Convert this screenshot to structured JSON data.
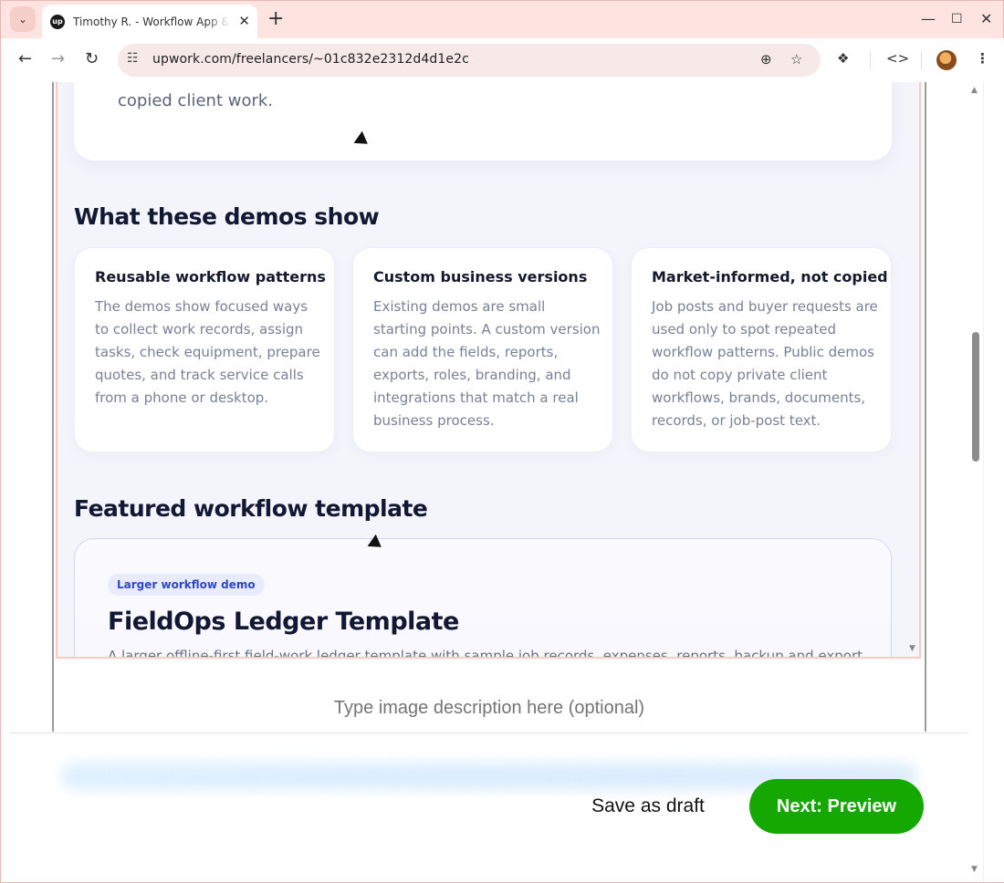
{
  "browser": {
    "tab_title": "Timothy R. - Workflow App &",
    "favicon_text": "up",
    "url": "upwork.com/freelancers/~01c832e2312d4d1e2c"
  },
  "preview": {
    "top_card_text": "copied client work.",
    "section_demos_title": "What these demos show",
    "features": [
      {
        "title": "Reusable workflow patterns",
        "body": "The demos show focused ways to collect work records, assign tasks, check equipment, prepare quotes, and track service calls from a phone or desktop."
      },
      {
        "title": "Custom business versions",
        "body": "Existing demos are small starting points. A custom version can add the fields, reports, exports, roles, branding, and integrations that match a real business process."
      },
      {
        "title": "Market-informed, not copied",
        "body": "Job posts and buyer requests are used only to spot repeated workflow patterns. Public demos do not copy private client workflows, brands, documents, records, or job-post text."
      }
    ],
    "section_featured_title": "Featured workflow template",
    "template": {
      "badge": "Larger workflow demo",
      "title": "FieldOps Ledger Template",
      "description": "A larger offline-first field-work ledger template with sample job records, expenses, reports, backup and export"
    }
  },
  "description_input": {
    "placeholder": "Type image description here (optional)"
  },
  "footer": {
    "save_draft_label": "Save as draft",
    "next_label": "Next: Preview",
    "next_color": "#14a800"
  }
}
